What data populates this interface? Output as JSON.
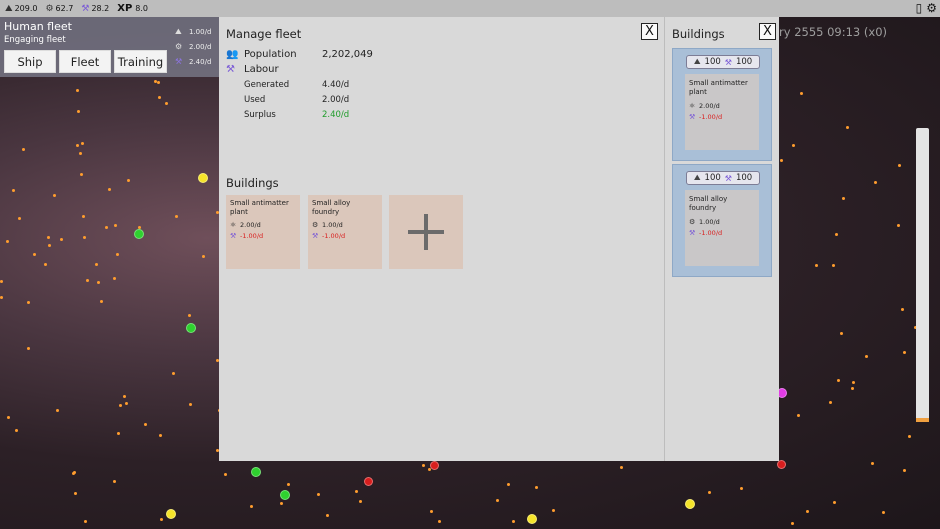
{
  "topbar": {
    "resources": [
      {
        "icon": "ore-icon",
        "value": "209.0"
      },
      {
        "icon": "alloy-icon",
        "value": "62.7"
      },
      {
        "icon": "labour-icon",
        "value": "28.2"
      }
    ],
    "xp_label": "XP",
    "xp_value": "8.0"
  },
  "fleet_panel": {
    "name": "Human fleet",
    "state": "Engaging fleet",
    "buttons": [
      "Ship",
      "Fleet",
      "Training"
    ],
    "rates": [
      {
        "icon": "ore-icon",
        "value": "1.00/d"
      },
      {
        "icon": "alloy-icon",
        "value": "2.00/d"
      },
      {
        "icon": "labour-icon",
        "value": "2.40/d"
      }
    ]
  },
  "date_text": "ry 2555 09:13 (x0)",
  "manage_fleet": {
    "title": "Manage fleet",
    "close_label": "X",
    "population_label": "Population",
    "population_value": "2,202,049",
    "labour_label": "Labour",
    "generated_label": "Generated",
    "generated_value": "4.40/d",
    "used_label": "Used",
    "used_value": "2.00/d",
    "surplus_label": "Surplus",
    "surplus_value": "2.40/d",
    "buildings_title": "Buildings",
    "buildings": [
      {
        "name": "Small antimatter plant",
        "output": "2.00/d",
        "output_icon": "antimatter-icon",
        "labour": "-1.00/d"
      },
      {
        "name": "Small alloy foundry",
        "output": "1.00/d",
        "output_icon": "alloy-icon",
        "labour": "-1.00/d"
      }
    ]
  },
  "buildings_panel": {
    "title": "Buildings",
    "close_label": "X",
    "offers": [
      {
        "cost_ore": "100",
        "cost_labour": "100",
        "name": "Small antimatter plant",
        "output": "2.00/d",
        "output_icon": "antimatter-icon",
        "labour": "-1.00/d"
      },
      {
        "cost_ore": "100",
        "cost_labour": "100",
        "name": "Small alloy foundry",
        "output": "1.00/d",
        "output_icon": "alloy-icon",
        "labour": "-1.00/d"
      }
    ]
  },
  "colors": {
    "surplus_green": "#1f9c2a",
    "negative_red": "#d92020",
    "labour_purple": "#7a5ad6",
    "building_card": "#dbc7bb",
    "offer_card": "#a9bfd7"
  }
}
